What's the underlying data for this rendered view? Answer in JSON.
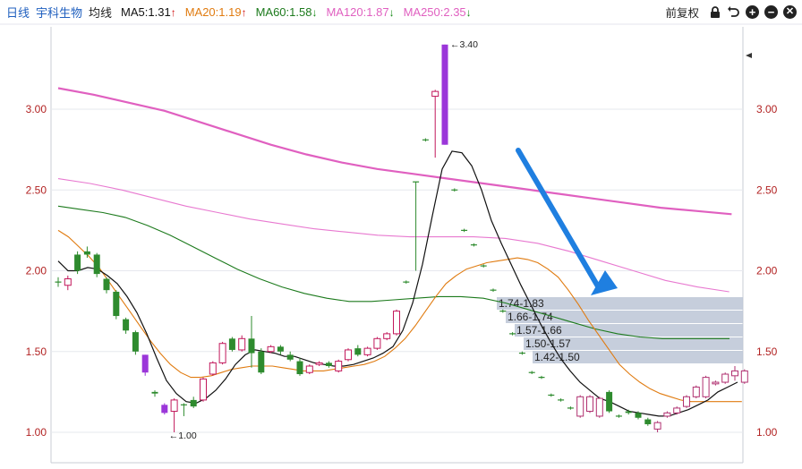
{
  "toolbar": {
    "period": "日线",
    "stock_name": "宇科生物",
    "avg_line": "均线",
    "restore": "前复权"
  },
  "moving_averages": [
    {
      "label": "MA5:1.31",
      "arrow": "↑",
      "color": "#111111"
    },
    {
      "label": "MA20:1.19",
      "arrow": "↑",
      "color": "#e07b10"
    },
    {
      "label": "MA60:1.58",
      "arrow": "↓",
      "color": "#1c7a1c"
    },
    {
      "label": "MA120:1.87",
      "arrow": "↓",
      "color": "#e060c0"
    },
    {
      "label": "MA250:2.35",
      "arrow": "↓",
      "color": "#e060c0"
    }
  ],
  "icons": [
    "lock-icon",
    "undo-icon",
    "zoom-in-icon",
    "zoom-out-icon",
    "close-icon"
  ],
  "chart_data": {
    "type": "candlestick",
    "y_ticks": [
      "3.00",
      "2.50",
      "2.00",
      "1.50",
      "1.00"
    ],
    "ylim": [
      0.8,
      3.52
    ],
    "annotations": {
      "high": "3.40",
      "low": "1.00"
    },
    "candles": [
      [
        1.93,
        1.93,
        1.9,
        1.96
      ],
      [
        1.91,
        1.95,
        1.88,
        1.97
      ],
      [
        2.1,
        2.0,
        1.98,
        2.12
      ],
      [
        2.12,
        2.1,
        2.08,
        2.15
      ],
      [
        2.1,
        1.98,
        1.96,
        2.11
      ],
      [
        1.95,
        1.88,
        1.86,
        1.96
      ],
      [
        1.87,
        1.72,
        1.7,
        1.88
      ],
      [
        1.7,
        1.63,
        1.61,
        1.71
      ],
      [
        1.62,
        1.5,
        1.48,
        1.63
      ],
      [
        1.48,
        1.37,
        1.35,
        1.48
      ],
      [
        1.25,
        1.24,
        1.22,
        1.26
      ],
      [
        1.17,
        1.12,
        1.11,
        1.18
      ],
      [
        1.13,
        1.2,
        1.0,
        1.21
      ],
      [
        1.17,
        1.17,
        1.1,
        1.18
      ],
      [
        1.2,
        1.16,
        1.15,
        1.22
      ],
      [
        1.2,
        1.33,
        1.19,
        1.34
      ],
      [
        1.36,
        1.43,
        1.35,
        1.44
      ],
      [
        1.43,
        1.55,
        1.42,
        1.56
      ],
      [
        1.58,
        1.51,
        1.5,
        1.59
      ],
      [
        1.51,
        1.58,
        1.5,
        1.6
      ],
      [
        1.58,
        1.49,
        1.4,
        1.72
      ],
      [
        1.5,
        1.37,
        1.36,
        1.52
      ],
      [
        1.5,
        1.53,
        1.49,
        1.54
      ],
      [
        1.53,
        1.5,
        1.48,
        1.54
      ],
      [
        1.48,
        1.45,
        1.44,
        1.5
      ],
      [
        1.44,
        1.36,
        1.35,
        1.46
      ],
      [
        1.37,
        1.41,
        1.36,
        1.42
      ],
      [
        1.42,
        1.43,
        1.41,
        1.44
      ],
      [
        1.43,
        1.41,
        1.4,
        1.44
      ],
      [
        1.38,
        1.44,
        1.37,
        1.45
      ],
      [
        1.45,
        1.51,
        1.44,
        1.52
      ],
      [
        1.52,
        1.48,
        1.47,
        1.54
      ],
      [
        1.48,
        1.52,
        1.47,
        1.53
      ],
      [
        1.52,
        1.58,
        1.51,
        1.59
      ],
      [
        1.58,
        1.61,
        1.57,
        1.62
      ],
      [
        1.61,
        1.75,
        1.6,
        1.76
      ],
      [
        1.93,
        1.93,
        1.92,
        1.94
      ],
      [
        2.55,
        2.55,
        2.0,
        2.55
      ],
      [
        2.81,
        2.81,
        2.8,
        2.82
      ],
      [
        3.08,
        3.11,
        2.7,
        3.12
      ],
      [
        3.4,
        2.78,
        2.78,
        3.4
      ],
      [
        2.5,
        2.5,
        2.49,
        2.51
      ],
      [
        2.25,
        2.25,
        2.24,
        2.26
      ],
      [
        2.16,
        2.16,
        2.15,
        2.17
      ],
      [
        2.03,
        2.03,
        2.02,
        2.04
      ],
      [
        1.88,
        1.88,
        1.87,
        1.89
      ],
      [
        1.75,
        1.75,
        1.74,
        1.76
      ],
      [
        1.61,
        1.61,
        1.6,
        1.62
      ],
      [
        1.49,
        1.49,
        1.48,
        1.5
      ],
      [
        1.37,
        1.37,
        1.36,
        1.38
      ],
      [
        1.34,
        1.34,
        1.33,
        1.35
      ],
      [
        1.23,
        1.23,
        1.22,
        1.24
      ],
      [
        1.2,
        1.2,
        1.19,
        1.21
      ],
      [
        1.15,
        1.15,
        1.14,
        1.16
      ],
      [
        1.1,
        1.22,
        1.09,
        1.23
      ],
      [
        1.13,
        1.22,
        1.12,
        1.23
      ],
      [
        1.1,
        1.21,
        1.09,
        1.22
      ],
      [
        1.25,
        1.13,
        1.12,
        1.26
      ],
      [
        1.1,
        1.1,
        1.09,
        1.11
      ],
      [
        1.13,
        1.12,
        1.11,
        1.14
      ],
      [
        1.12,
        1.09,
        1.08,
        1.13
      ],
      [
        1.08,
        1.05,
        1.04,
        1.09
      ],
      [
        1.02,
        1.06,
        1.0,
        1.07
      ],
      [
        1.1,
        1.12,
        1.09,
        1.13
      ],
      [
        1.12,
        1.15,
        1.11,
        1.16
      ],
      [
        1.16,
        1.22,
        1.15,
        1.23
      ],
      [
        1.22,
        1.28,
        1.21,
        1.29
      ],
      [
        1.22,
        1.34,
        1.21,
        1.35
      ],
      [
        1.3,
        1.31,
        1.29,
        1.32
      ],
      [
        1.31,
        1.36,
        1.3,
        1.37
      ],
      [
        1.35,
        1.38,
        1.32,
        1.41
      ],
      [
        1.31,
        1.38,
        1.3,
        1.39
      ]
    ],
    "ma5": [
      2.06,
      2.0,
      2.0,
      2.02,
      2.01,
      1.97,
      1.92,
      1.84,
      1.74,
      1.61,
      1.46,
      1.32,
      1.24,
      1.19,
      1.18,
      1.21,
      1.26,
      1.33,
      1.42,
      1.48,
      1.51,
      1.5,
      1.49,
      1.47,
      1.47,
      1.45,
      1.43,
      1.42,
      1.41,
      1.41,
      1.42,
      1.44,
      1.46,
      1.49,
      1.53,
      1.63,
      1.8,
      2.04,
      2.34,
      2.63,
      2.74,
      2.73,
      2.65,
      2.5,
      2.31,
      2.17,
      2.04,
      1.91,
      1.79,
      1.67,
      1.56,
      1.46,
      1.38,
      1.31,
      1.26,
      1.21,
      1.19,
      1.16,
      1.13,
      1.12,
      1.11,
      1.1,
      1.1,
      1.12,
      1.14,
      1.17,
      1.2,
      1.25,
      1.28,
      1.31
    ],
    "ma20": [
      2.25,
      2.21,
      2.15,
      2.09,
      2.02,
      1.93,
      1.84,
      1.75,
      1.66,
      1.57,
      1.49,
      1.42,
      1.37,
      1.34,
      1.34,
      1.35,
      1.37,
      1.39,
      1.4,
      1.41,
      1.41,
      1.41,
      1.4,
      1.39,
      1.38,
      1.38,
      1.38,
      1.39,
      1.4,
      1.41,
      1.42,
      1.44,
      1.47,
      1.52,
      1.58,
      1.66,
      1.75,
      1.84,
      1.92,
      1.97,
      2.01,
      2.03,
      2.05,
      2.06,
      2.07,
      2.08,
      2.07,
      2.05,
      2.01,
      1.96,
      1.88,
      1.79,
      1.69,
      1.6,
      1.51,
      1.42,
      1.36,
      1.31,
      1.27,
      1.24,
      1.22,
      1.2,
      1.19,
      1.19,
      1.19,
      1.19,
      1.19,
      1.19
    ],
    "ma60": [
      2.4,
      2.38,
      2.36,
      2.33,
      2.28,
      2.22,
      2.15,
      2.08,
      2.01,
      1.95,
      1.9,
      1.86,
      1.83,
      1.81,
      1.81,
      1.82,
      1.83,
      1.84,
      1.84,
      1.83,
      1.8,
      1.76,
      1.72,
      1.68,
      1.64,
      1.61,
      1.59,
      1.58,
      1.58,
      1.58,
      1.58
    ],
    "ma120": [
      2.57,
      2.54,
      2.5,
      2.45,
      2.4,
      2.36,
      2.32,
      2.29,
      2.26,
      2.24,
      2.22,
      2.21,
      2.21,
      2.21,
      2.2,
      2.17,
      2.12,
      2.06,
      2.0,
      1.94,
      1.9,
      1.87
    ],
    "ma250": [
      3.13,
      3.09,
      3.04,
      2.99,
      2.92,
      2.85,
      2.78,
      2.72,
      2.67,
      2.63,
      2.6,
      2.57,
      2.54,
      2.51,
      2.48,
      2.45,
      2.42,
      2.39,
      2.37,
      2.35
    ],
    "price_ranges": [
      "1.74-1.83",
      "1.66-1.74",
      "1.57-1.66",
      "1.50-1.57",
      "1.42-1.50"
    ]
  }
}
